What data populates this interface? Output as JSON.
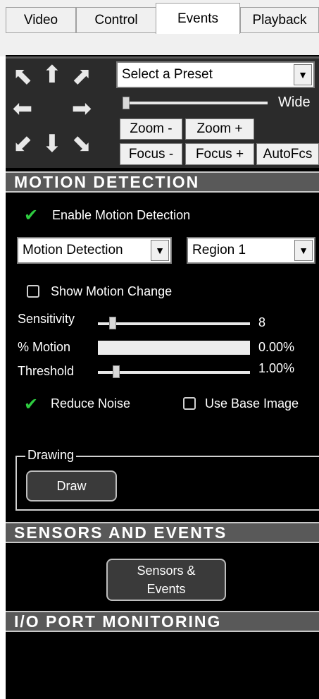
{
  "tabs": [
    {
      "label": "Video"
    },
    {
      "label": "Control"
    },
    {
      "label": "Events"
    },
    {
      "label": "Playback"
    }
  ],
  "ptz": {
    "preset_select": "Select a Preset",
    "zoom_label": "Wide",
    "zoom_level": 0.0,
    "zoom_out": "Zoom -",
    "zoom_in": "Zoom +",
    "focus_out": "Focus -",
    "focus_in": "Focus +",
    "autofocus": "AutoFcs"
  },
  "motion": {
    "header": "MOTION DETECTION",
    "enable_label": "Enable Motion Detection",
    "mode_select": "Motion Detection",
    "region_select": "Region 1",
    "show_change_label": "Show Motion Change",
    "sensitivity_label": "Sensitivity",
    "sensitivity_value": "8",
    "motion_label": "% Motion",
    "motion_value": "0.00%",
    "threshold_label": "Threshold",
    "threshold_value": "1.00%",
    "reduce_noise_label": "Reduce Noise",
    "base_image_label": "Use Base Image",
    "drawing_legend": "Drawing",
    "draw_button": "Draw"
  },
  "sensors": {
    "header": "SENSORS AND EVENTS",
    "button_line1": "Sensors &",
    "button_line2": "Events"
  },
  "io": {
    "header": "I/O PORT MONITORING"
  },
  "colors": {
    "check": "#2ecc40",
    "header_bg": "#595959",
    "panel_bg": "#000000"
  }
}
